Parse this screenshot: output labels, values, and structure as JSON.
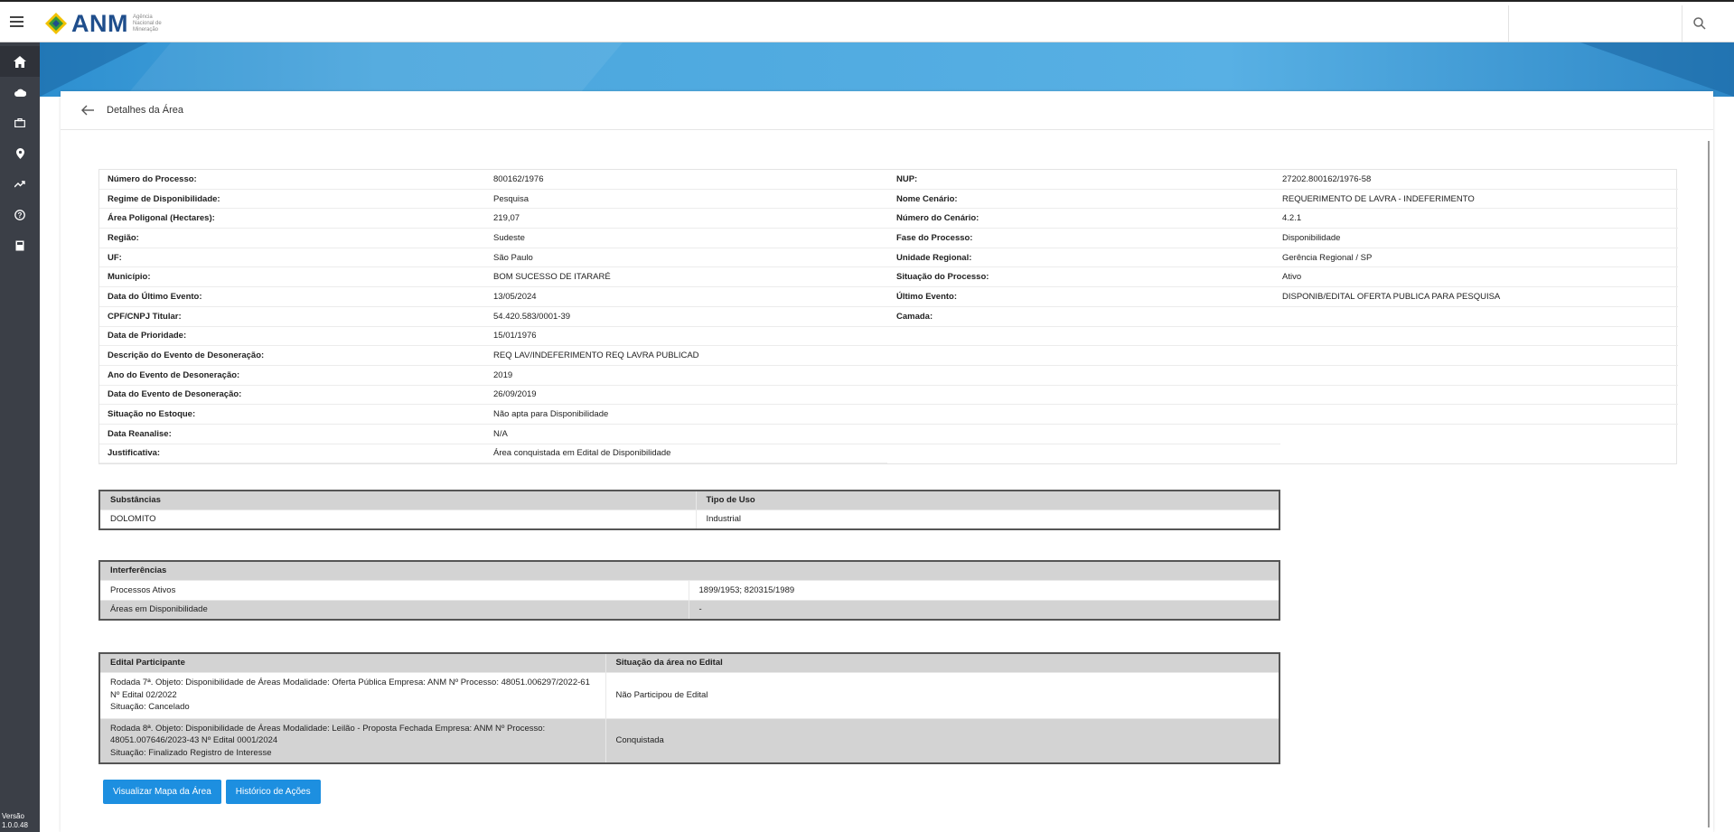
{
  "header": {
    "logo_text": "ANM",
    "logo_subtitle": "Agência Nacional de Mineração"
  },
  "sidebar": {
    "items": [
      {
        "icon": "home-icon"
      },
      {
        "icon": "cloud-icon"
      },
      {
        "icon": "briefcase-icon"
      },
      {
        "icon": "location-pin-icon"
      },
      {
        "icon": "trending-icon"
      },
      {
        "icon": "help-icon"
      },
      {
        "icon": "book-icon"
      }
    ],
    "version_label": "Versão",
    "version_number": "1.0.0.48"
  },
  "page": {
    "title": "Detalhes da Área"
  },
  "details": {
    "left": [
      {
        "label": "Número do Processo:",
        "value": "800162/1976"
      },
      {
        "label": "Regime de Disponibilidade:",
        "value": "Pesquisa"
      },
      {
        "label": "Área Poligonal (Hectares):",
        "value": "219,07"
      },
      {
        "label": "Região:",
        "value": "Sudeste"
      },
      {
        "label": "UF:",
        "value": "São Paulo"
      },
      {
        "label": "Município:",
        "value": "BOM SUCESSO DE ITARARÉ"
      },
      {
        "label": "Data do Último Evento:",
        "value": "13/05/2024"
      },
      {
        "label": "CPF/CNPJ Titular:",
        "value": "54.420.583/0001-39"
      },
      {
        "label": "Data de Prioridade:",
        "value": "15/01/1976"
      },
      {
        "label": "Descrição do Evento de Desoneração:",
        "value": "REQ LAV/INDEFERIMENTO REQ LAVRA PUBLICAD"
      },
      {
        "label": "Ano do Evento de Desoneração:",
        "value": "2019"
      },
      {
        "label": "Data do Evento de Desoneração:",
        "value": "26/09/2019"
      },
      {
        "label": "Situação no Estoque:",
        "value": "Não apta para Disponibilidade"
      },
      {
        "label": "Data Reanalise:",
        "value": "N/A"
      },
      {
        "label": "Justificativa:",
        "value": "Área conquistada em Edital de Disponibilidade"
      }
    ],
    "right": [
      {
        "label": "NUP:",
        "value": "27202.800162/1976-58"
      },
      {
        "label": "Nome Cenário:",
        "value": "REQUERIMENTO DE LAVRA - INDEFERIMENTO"
      },
      {
        "label": "Número do Cenário:",
        "value": "4.2.1"
      },
      {
        "label": "Fase do Processo:",
        "value": "Disponibilidade"
      },
      {
        "label": "Unidade Regional:",
        "value": "Gerência Regional / SP"
      },
      {
        "label": "Situação do Processo:",
        "value": "Ativo"
      },
      {
        "label": "Último Evento:",
        "value": "DISPONIB/EDITAL OFERTA PUBLICA PARA PESQUISA"
      },
      {
        "label": "Camada:",
        "value": ""
      }
    ]
  },
  "substancias": {
    "headers": [
      "Substâncias",
      "Tipo de Uso"
    ],
    "rows": [
      [
        "DOLOMITO",
        "Industrial"
      ]
    ]
  },
  "interferencias": {
    "header": "Interferências",
    "rows": [
      [
        "Processos Ativos",
        "1899/1953; 820315/1989"
      ],
      [
        "Áreas em Disponibilidade",
        "-"
      ]
    ]
  },
  "editais": {
    "headers": [
      "Edital Participante",
      "Situação da área no Edital"
    ],
    "rows": [
      {
        "lines": [
          "Rodada 7ª. Objeto: Disponibilidade de Áreas Modalidade: Oferta Pública Empresa: ANM Nº Processo: 48051.006297/2022-61",
          "Nº Edital 02/2022",
          "Situação: Cancelado"
        ],
        "status": "Não Participou de Edital"
      },
      {
        "lines": [
          "Rodada 8ª. Objeto: Disponibilidade de Áreas Modalidade: Leilão - Proposta Fechada Empresa: ANM Nº Processo:",
          "48051.007646/2023-43 Nº Edital 0001/2024",
          "Situação: Finalizado Registro de Interesse"
        ],
        "status": "Conquistada"
      }
    ]
  },
  "actions": {
    "map_button": "Visualizar Mapa da Área",
    "history_button": "Histórico de Ações"
  },
  "colors": {
    "accent": "#1d8fe0",
    "sidebar": "#3b3f47",
    "brand": "#1f4e8c"
  }
}
